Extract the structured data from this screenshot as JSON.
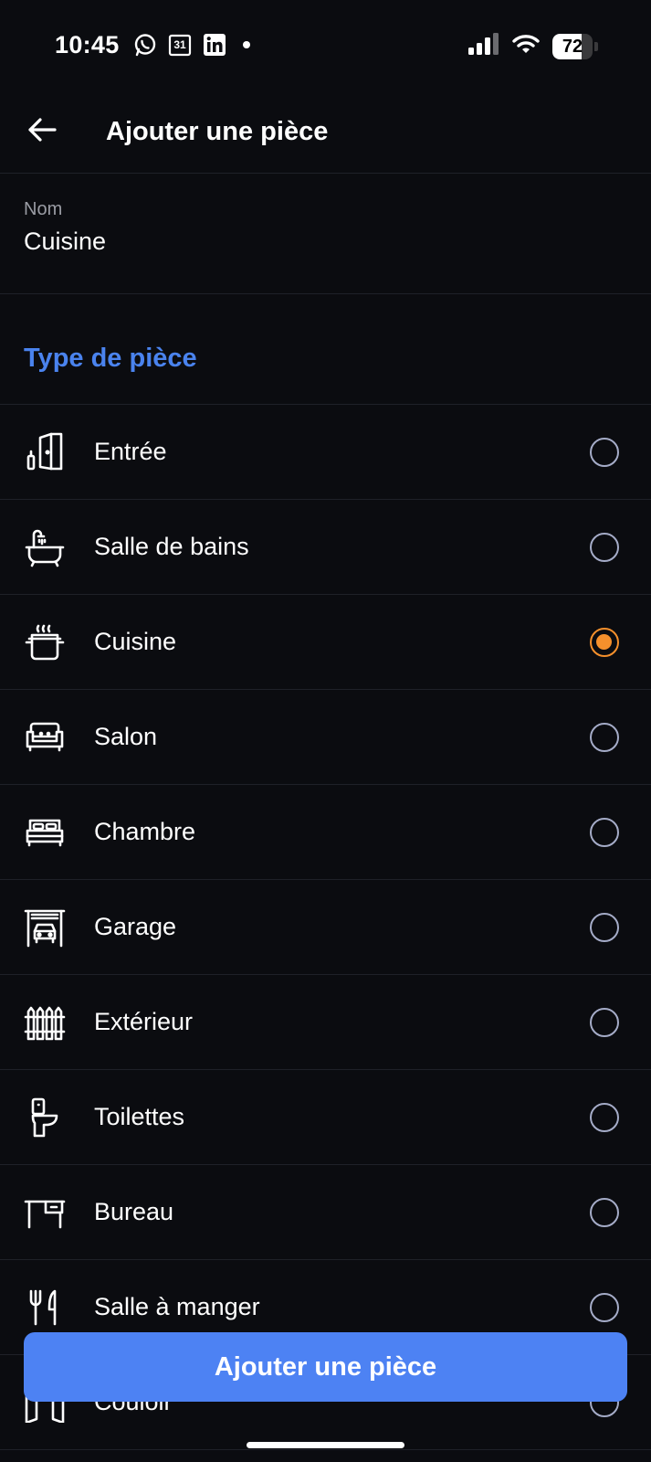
{
  "status_bar": {
    "time": "10:45",
    "calendar_day": "31",
    "battery_percent": "72",
    "battery_level": 0.72
  },
  "header": {
    "title": "Ajouter une pièce"
  },
  "name_field": {
    "label": "Nom",
    "value": "Cuisine"
  },
  "room_type": {
    "section_title": "Type de pièce",
    "selected": "Cuisine",
    "items": [
      {
        "label": "Entrée",
        "icon": "door-icon"
      },
      {
        "label": "Salle de bains",
        "icon": "bathtub-icon"
      },
      {
        "label": "Cuisine",
        "icon": "cooking-pot-icon"
      },
      {
        "label": "Salon",
        "icon": "sofa-icon"
      },
      {
        "label": "Chambre",
        "icon": "bed-icon"
      },
      {
        "label": "Garage",
        "icon": "garage-icon"
      },
      {
        "label": "Extérieur",
        "icon": "fence-icon"
      },
      {
        "label": "Toilettes",
        "icon": "toilet-icon"
      },
      {
        "label": "Bureau",
        "icon": "desk-icon"
      },
      {
        "label": "Salle à manger",
        "icon": "fork-knife-icon"
      },
      {
        "label": "Couloir",
        "icon": "hallway-icon"
      }
    ]
  },
  "footer": {
    "add_button_label": "Ajouter une pièce"
  },
  "colors": {
    "background": "#0b0c10",
    "accent_blue": "#4d82f3",
    "section_blue": "#4a83ee",
    "radio_selected": "#f5902c",
    "radio_unselected": "#a5acc8"
  }
}
